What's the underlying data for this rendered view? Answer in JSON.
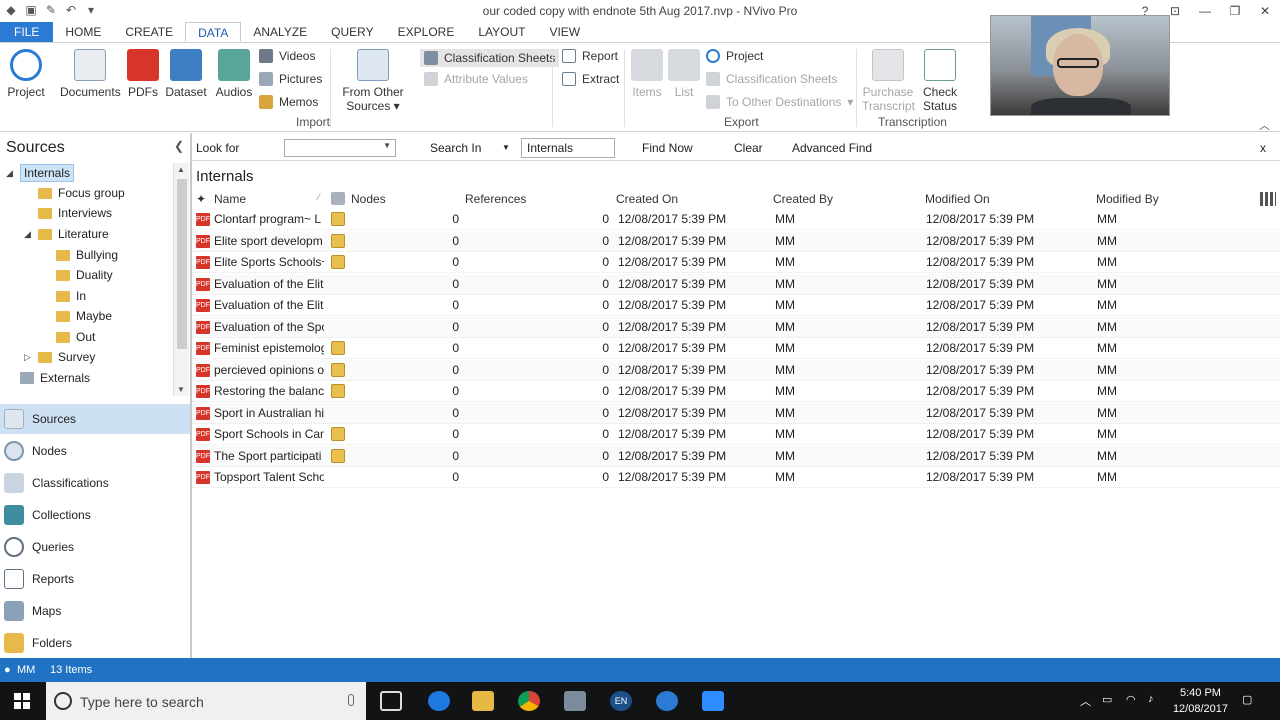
{
  "window": {
    "title": "our coded copy with endnote 5th Aug 2017.nvp - NVivo Pro",
    "controls": [
      "?",
      "⊡",
      "—",
      "❐",
      "✕"
    ]
  },
  "tabs": [
    "FILE",
    "HOME",
    "CREATE",
    "DATA",
    "ANALYZE",
    "QUERY",
    "EXPLORE",
    "LAYOUT",
    "VIEW"
  ],
  "ribbon": {
    "project": "Project",
    "documents": "Documents",
    "pdfs": "PDFs",
    "dataset": "Dataset",
    "audios": "Audios",
    "videos": "Videos",
    "pictures": "Pictures",
    "memos": "Memos",
    "from_other_1": "From Other",
    "from_other_2": "Sources ▾",
    "classification_sheets": "Classification Sheets",
    "attribute_values": "Attribute Values",
    "report": "Report",
    "extract": "Extract",
    "items": "Items",
    "list": "List",
    "export_project": "Project",
    "export_class_sheets": "Classification Sheets",
    "to_other_destinations": "To Other Destinations",
    "purchase_1": "Purchase",
    "purchase_2": "Transcript",
    "check_1": "Check",
    "check_2": "Status",
    "group_import": "Import",
    "group_export": "Export",
    "group_transcription": "Transcription"
  },
  "nav": {
    "title": "Sources",
    "tree": [
      {
        "label": "Internals",
        "level": 0,
        "expander": "◢",
        "selected": true
      },
      {
        "label": "Focus group",
        "level": 1,
        "expander": ""
      },
      {
        "label": "Interviews",
        "level": 1,
        "expander": ""
      },
      {
        "label": "Literature",
        "level": 1,
        "expander": "◢"
      },
      {
        "label": "Bullying",
        "level": 2,
        "expander": ""
      },
      {
        "label": "Duality",
        "level": 2,
        "expander": ""
      },
      {
        "label": "In",
        "level": 2,
        "expander": ""
      },
      {
        "label": "Maybe",
        "level": 2,
        "expander": ""
      },
      {
        "label": "Out",
        "level": 2,
        "expander": ""
      },
      {
        "label": "Survey",
        "level": 1,
        "expander": "▷"
      },
      {
        "label": "Externals",
        "level": 0,
        "expander": ""
      }
    ],
    "buttons": [
      "Sources",
      "Nodes",
      "Classifications",
      "Collections",
      "Queries",
      "Reports",
      "Maps",
      "Folders"
    ]
  },
  "findbar": {
    "look_for": "Look for",
    "search_in": "Search In",
    "search_in_value": "Internals",
    "find_now": "Find Now",
    "clear": "Clear",
    "advanced_find": "Advanced Find",
    "close": "x"
  },
  "content": {
    "title": "Internals",
    "columns": [
      "Name",
      "Nodes",
      "References",
      "Created On",
      "Created By",
      "Modified On",
      "Modified By"
    ],
    "rows": [
      {
        "name": "Clontarf program~ L",
        "annot": true,
        "nodes": "0",
        "refs": "0",
        "created_on": "12/08/2017 5:39 PM",
        "created_by": "MM",
        "modified_on": "12/08/2017 5:39 PM",
        "modified_by": "MM"
      },
      {
        "name": "Elite sport developm",
        "annot": true,
        "nodes": "0",
        "refs": "0",
        "created_on": "12/08/2017 5:39 PM",
        "created_by": "MM",
        "modified_on": "12/08/2017 5:39 PM",
        "modified_by": "MM"
      },
      {
        "name": "Elite Sports Schools~",
        "annot": true,
        "nodes": "0",
        "refs": "0",
        "created_on": "12/08/2017 5:39 PM",
        "created_by": "MM",
        "modified_on": "12/08/2017 5:39 PM",
        "modified_by": "MM"
      },
      {
        "name": "Evaluation of the Elit",
        "annot": false,
        "nodes": "0",
        "refs": "0",
        "created_on": "12/08/2017 5:39 PM",
        "created_by": "MM",
        "modified_on": "12/08/2017 5:39 PM",
        "modified_by": "MM"
      },
      {
        "name": "Evaluation of the Elit",
        "annot": false,
        "nodes": "0",
        "refs": "0",
        "created_on": "12/08/2017 5:39 PM",
        "created_by": "MM",
        "modified_on": "12/08/2017 5:39 PM",
        "modified_by": "MM"
      },
      {
        "name": "Evaluation of the Spo",
        "annot": false,
        "nodes": "0",
        "refs": "0",
        "created_on": "12/08/2017 5:39 PM",
        "created_by": "MM",
        "modified_on": "12/08/2017 5:39 PM",
        "modified_by": "MM"
      },
      {
        "name": "Feminist epistemolog",
        "annot": true,
        "nodes": "0",
        "refs": "0",
        "created_on": "12/08/2017 5:39 PM",
        "created_by": "MM",
        "modified_on": "12/08/2017 5:39 PM",
        "modified_by": "MM"
      },
      {
        "name": "percieved opinions o",
        "annot": true,
        "nodes": "0",
        "refs": "0",
        "created_on": "12/08/2017 5:39 PM",
        "created_by": "MM",
        "modified_on": "12/08/2017 5:39 PM",
        "modified_by": "MM"
      },
      {
        "name": "Restoring the balanc",
        "annot": true,
        "nodes": "0",
        "refs": "0",
        "created_on": "12/08/2017 5:39 PM",
        "created_by": "MM",
        "modified_on": "12/08/2017 5:39 PM",
        "modified_by": "MM"
      },
      {
        "name": "Sport in Australian hi",
        "annot": false,
        "nodes": "0",
        "refs": "0",
        "created_on": "12/08/2017 5:39 PM",
        "created_by": "MM",
        "modified_on": "12/08/2017 5:39 PM",
        "modified_by": "MM"
      },
      {
        "name": "Sport Schools in Can",
        "annot": true,
        "nodes": "0",
        "refs": "0",
        "created_on": "12/08/2017 5:39 PM",
        "created_by": "MM",
        "modified_on": "12/08/2017 5:39 PM",
        "modified_by": "MM"
      },
      {
        "name": "The Sport participati",
        "annot": true,
        "nodes": "0",
        "refs": "0",
        "created_on": "12/08/2017 5:39 PM",
        "created_by": "MM",
        "modified_on": "12/08/2017 5:39 PM",
        "modified_by": "MM"
      },
      {
        "name": "Topsport Talent Scho",
        "annot": false,
        "nodes": "0",
        "refs": "0",
        "created_on": "12/08/2017 5:39 PM",
        "created_by": "MM",
        "modified_on": "12/08/2017 5:39 PM",
        "modified_by": "MM"
      }
    ]
  },
  "status": {
    "user": "MM",
    "items": "13 Items"
  },
  "taskbar": {
    "search_placeholder": "Type here to search",
    "lang": "EN",
    "time": "5:40 PM",
    "date": "12/08/2017"
  },
  "colors": {
    "accent": "#2b7bd5",
    "statusbar": "#1f72c4",
    "folder": "#e6b94a",
    "pdf": "#d8352a"
  }
}
